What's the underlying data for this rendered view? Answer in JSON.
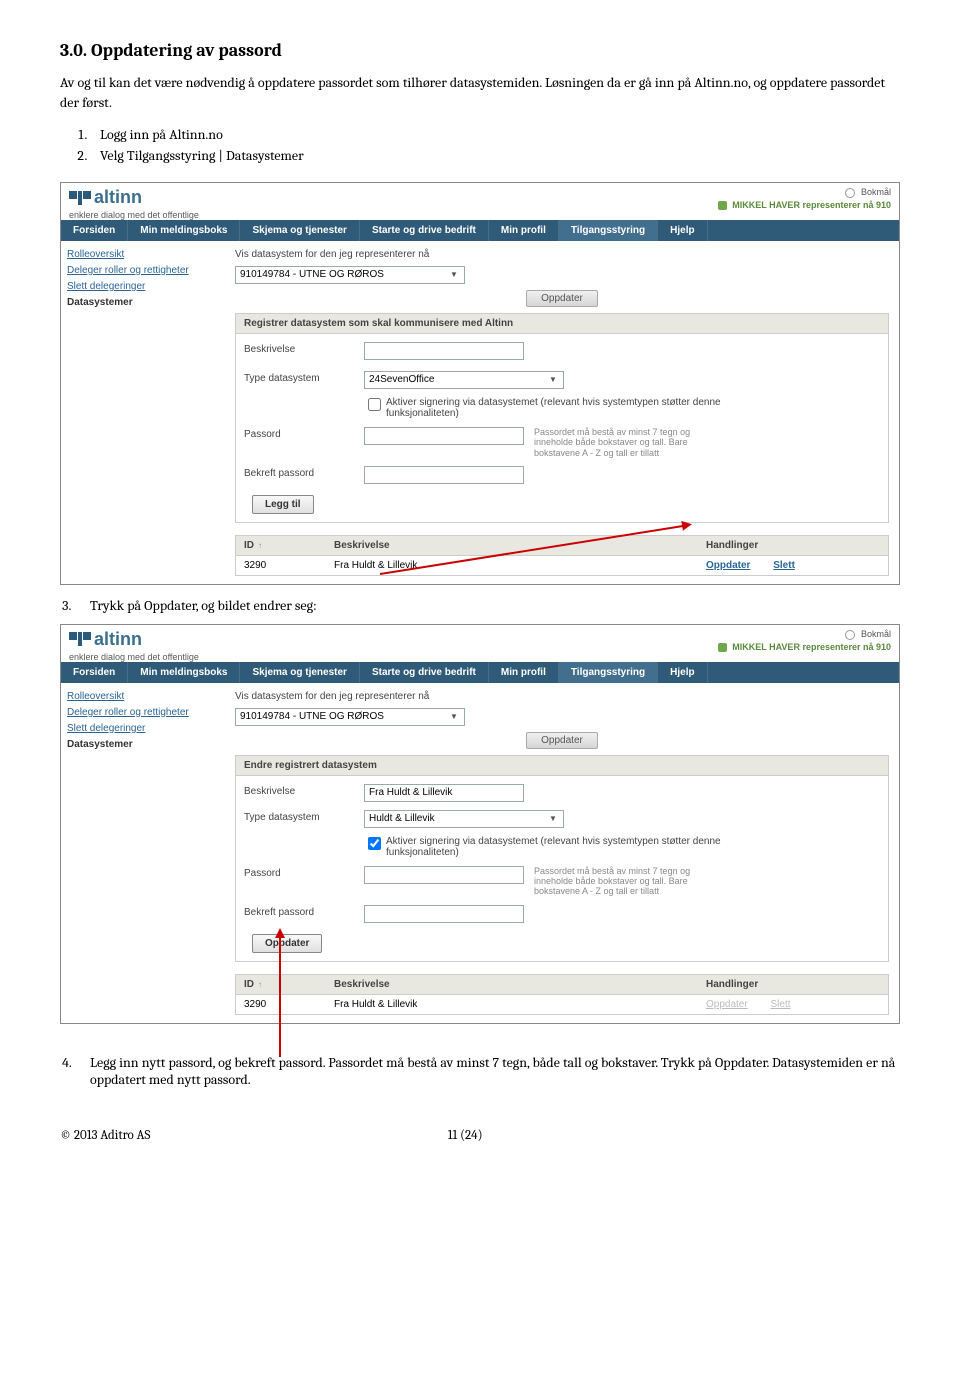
{
  "heading": "3.0.  Oppdatering av passord",
  "intro": "Av og til kan det være nødvendig å oppdatere passordet som tilhører datasystemiden. Løsningen da er gå inn på Altinn.no, og oppdatere passordet der først.",
  "steps12": {
    "s1": "Logg inn på Altinn.no",
    "s2": "Velg Tilgangsstyring | Datasystemer"
  },
  "step3": "Trykk på Oppdater, og bildet endrer seg:",
  "step4": "Legg inn nytt passord, og bekreft passord. Passordet må  bestå av minst 7 tegn, både tall og bokstaver. Trykk på Oppdater. Datasystemiden er nå oppdatert med nytt passord.",
  "altinn": {
    "brand": "altinn",
    "tagline": "enklere dialog med det offentlige",
    "lang_label": "Bokmål",
    "user_line": "MIKKEL HAVER representerer nå 910",
    "nav": {
      "forsiden": "Forsiden",
      "meldingsboks": "Min meldingsboks",
      "skjema": "Skjema og tjenester",
      "starte": "Starte og drive bedrift",
      "profil": "Min profil",
      "tilgang": "Tilgangsstyring",
      "hjelp": "Hjelp"
    },
    "sidebar": {
      "rolleoversikt": "Rolleoversikt",
      "deleger": "Deleger roller og rettigheter",
      "slett": "Slett delegeringer",
      "datasys": "Datasystemer"
    },
    "main": {
      "vis_label": "Vis datasystem for den jeg representerer nå",
      "org": "910149784 - UTNE OG RØROS",
      "oppdater_btn": "Oppdater"
    },
    "section1": {
      "title": "Registrer datasystem som skal kommunisere med Altinn",
      "beskrivelse": "Beskrivelse",
      "type": "Type datasystem",
      "type_value": "24SevenOffice",
      "check_label": "Aktiver signering via datasystemet (relevant hvis systemtypen støtter denne funksjonaliteten)",
      "passord": "Passord",
      "bekreft": "Bekreft passord",
      "hint": "Passordet må bestå av minst 7 tegn og inneholde både bokstaver og tall. Bare bokstavene A - Z og tall er tillatt",
      "leggtil_btn": "Legg til"
    },
    "section2": {
      "title": "Endre registrert datasystem",
      "beskrivelse": "Beskrivelse",
      "beskrivelse_value": "Fra Huldt & Lillevik",
      "type": "Type datasystem",
      "type_value": "Huldt & Lillevik",
      "check_label": "Aktiver signering via datasystemet (relevant hvis systemtypen støtter denne funksjonaliteten)",
      "passord": "Passord",
      "bekreft": "Bekreft passord",
      "hint": "Passordet må bestå av minst 7 tegn og inneholde både bokstaver og tall. Bare bokstavene A - Z og tall er tillatt",
      "oppdater_btn": "Oppdater"
    },
    "table": {
      "col_id": "ID",
      "col_desc": "Beskrivelse",
      "col_act": "Handlinger",
      "row_id": "3290",
      "row_desc": "Fra Huldt & Lillevik",
      "act_oppdater": "Oppdater",
      "act_slett": "Slett"
    }
  },
  "footer": {
    "copyright": "© 2013 Aditro AS",
    "page": "11 (24)"
  }
}
